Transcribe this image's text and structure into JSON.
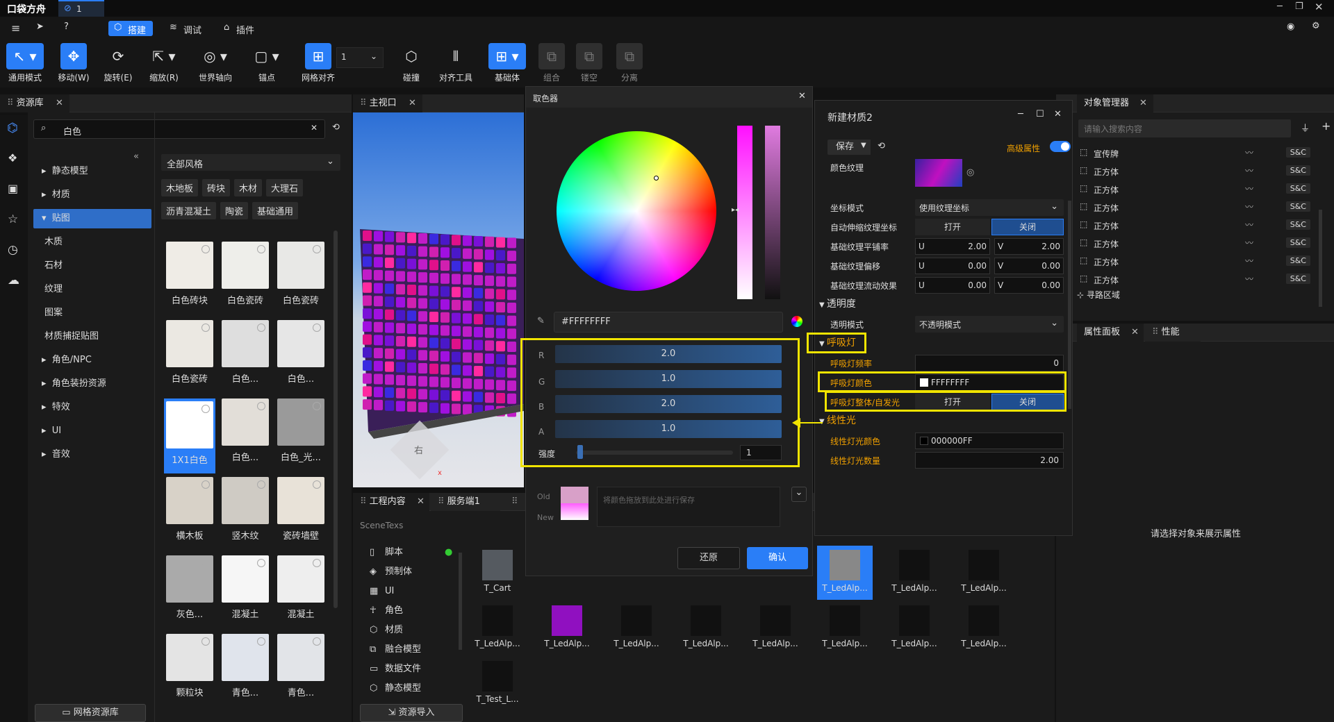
{
  "app": {
    "logo": "口袋方舟",
    "tab_label": "1"
  },
  "modes": {
    "build": "搭建",
    "debug": "调试",
    "plugin": "插件"
  },
  "toolbar": {
    "general": "通用模式",
    "move": "移动(W)",
    "rotate": "旋转(E)",
    "scale": "缩放(R)",
    "world": "世界轴向",
    "anchor": "锚点",
    "grid": "网格对齐",
    "grid_value": "1",
    "collide": "碰撞",
    "align": "对齐工具",
    "base": "基础体",
    "group": "组合",
    "hollow": "镂空",
    "separate": "分离"
  },
  "resource": {
    "tab": "资源库",
    "search_value": "白色",
    "style_select": "全部风格",
    "net_button": "网格资源库",
    "tree": [
      "静态模型",
      "材质",
      "贴图",
      "木质",
      "石材",
      "纹理",
      "图案",
      "材质捕捉贴图",
      "角色/NPC",
      "角色装扮资源",
      "特效",
      "UI",
      "音效"
    ],
    "tags": [
      "木地板",
      "砖块",
      "木材",
      "大理石",
      "沥青混凝土",
      "陶瓷",
      "基础通用"
    ],
    "assets": [
      "白色砖块",
      "白色瓷砖",
      "白色瓷砖",
      "白色瓷砖",
      "白色...",
      "白色...",
      "1X1白色",
      "白色...",
      "白色_光...",
      "横木板",
      "竖木纹",
      "瓷砖墙壁",
      "灰色...",
      "混凝土",
      "混凝土",
      "颗粒块",
      "青色...",
      "青色..."
    ]
  },
  "viewport": {
    "tab": "主视口",
    "cube_label": "右"
  },
  "project": {
    "tab": "工程内容",
    "server_tab": "服务端1",
    "folder": "SceneTexs",
    "import_button": "资源导入",
    "tree": [
      "脚本",
      "预制体",
      "UI",
      "角色",
      "材质",
      "融合模型",
      "数据文件",
      "静态模型"
    ],
    "files": [
      "T_Cart",
      "T_LedAlp...",
      "T_LedAlp...",
      "T_LedAlp...",
      "T_LedAlp...",
      "T_LedAlp...",
      "T_LedAlp...",
      "T_LedAlp...",
      "T_LedAlp...",
      "T_LedAlp...",
      "T_LedAlp...",
      "T_LedAlp...",
      "T_LedAlp...",
      "T_Test_L..."
    ]
  },
  "picker": {
    "title": "取色器",
    "hex": "#FFFFFFFF",
    "r_label": "R",
    "g_label": "G",
    "b_label": "B",
    "a_label": "A",
    "r": "2.0",
    "g": "1.0",
    "b": "2.0",
    "a": "1.0",
    "intensity_label": "强度",
    "intensity": "1",
    "old_label": "Old",
    "new_label": "New",
    "drop_hint": "将颜色拖放到此处进行保存",
    "reset": "还原",
    "confirm": "确认"
  },
  "material": {
    "title": "新建材质2",
    "save": "保存",
    "advanced": "高级属性",
    "color_texture": "颜色纹理",
    "coord_mode_label": "坐标模式",
    "coord_mode": "使用纹理坐标",
    "auto_stretch": "自动伸缩纹理坐标",
    "on": "打开",
    "off": "关闭",
    "tiling": "基础纹理平铺率",
    "offset": "基础纹理偏移",
    "flow": "基础纹理流动效果",
    "u": "U",
    "v": "V",
    "tiling_u": "2.00",
    "tiling_v": "2.00",
    "offset_u": "0.00",
    "offset_v": "0.00",
    "flow_u": "0.00",
    "flow_v": "0.00",
    "transparency_section": "透明度",
    "transparency_mode_label": "透明模式",
    "transparency_mode": "不透明模式",
    "breath_section": "呼吸灯",
    "breath_freq": "呼吸灯频率",
    "breath_freq_value": "0",
    "breath_color": "呼吸灯颜色",
    "breath_color_value": "FFFFFFFF",
    "breath_whole": "呼吸灯整体/自发光",
    "linear_section": "线性光",
    "linear_color": "线性灯光颜色",
    "linear_color_value": "000000FF",
    "linear_count": "线性灯光数量",
    "linear_count_value": "2.00"
  },
  "objects": {
    "tab": "对象管理器",
    "search_placeholder": "请输入搜索内容",
    "badge": "S&C",
    "items": [
      "宣传牌",
      "正方体",
      "正方体",
      "正方体",
      "正方体",
      "正方体",
      "正方体",
      "正方体"
    ],
    "nav": "寻路区域"
  },
  "props": {
    "tab": "属性面板",
    "perf_tab": "性能",
    "empty": "请选择对象来展示属性"
  }
}
